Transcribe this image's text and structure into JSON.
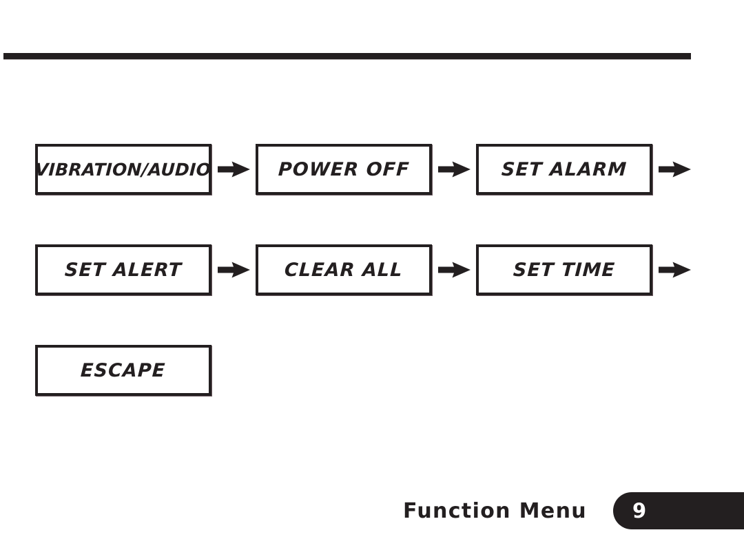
{
  "page": {
    "divider": "horizontal-rule"
  },
  "flow": {
    "rows": [
      {
        "items": [
          {
            "label": "VIBRATION/AUDIO",
            "arrow_after": true
          },
          {
            "label": "POWER OFF",
            "arrow_after": true
          },
          {
            "label": "SET ALARM",
            "arrow_after": true
          }
        ]
      },
      {
        "items": [
          {
            "label": "SET ALERT",
            "arrow_after": true
          },
          {
            "label": "CLEAR ALL",
            "arrow_after": true
          },
          {
            "label": "SET TIME",
            "arrow_after": true
          }
        ]
      },
      {
        "items": [
          {
            "label": "ESCAPE",
            "arrow_after": false
          }
        ]
      }
    ]
  },
  "footer": {
    "caption": "Function Menu",
    "page_number": "9"
  },
  "colors": {
    "ink": "#231f20",
    "paper": "#ffffff",
    "tab_text": "#ffffff"
  }
}
